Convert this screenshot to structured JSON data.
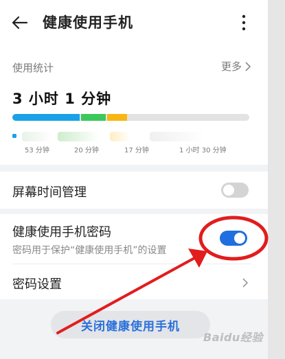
{
  "header": {
    "title": "健康使用手机",
    "back_icon": "arrow-left-icon",
    "more_icon": "more-vertical-icon"
  },
  "stats": {
    "label": "使用统计",
    "more_label": "更多",
    "total_time": "3 小时 1 分钟",
    "bar_colors": [
      "#1aa1e8",
      "#3cc85a",
      "#f7b614",
      "#e3e3e3"
    ],
    "bar_fractions": [
      0.29,
      0.11,
      0.09,
      0.51
    ],
    "app_times": [
      "53 分钟",
      "20 分钟",
      "17 分钟",
      "1 小时 30 分钟"
    ]
  },
  "screen_time": {
    "label": "屏幕时间管理",
    "enabled": false
  },
  "password": {
    "label": "健康使用手机密码",
    "description": "密码用于保护“健康使用手机”的设置",
    "enabled": true,
    "settings_label": "密码设置"
  },
  "footer": {
    "close_label": "关闭健康使用手机"
  },
  "colors": {
    "accent": "#2a6fdb",
    "toggle_on": "#1f6fe0",
    "toggle_off": "#d4d4d4",
    "annotation": "#e11d1d"
  },
  "watermark": "Baidu经验"
}
